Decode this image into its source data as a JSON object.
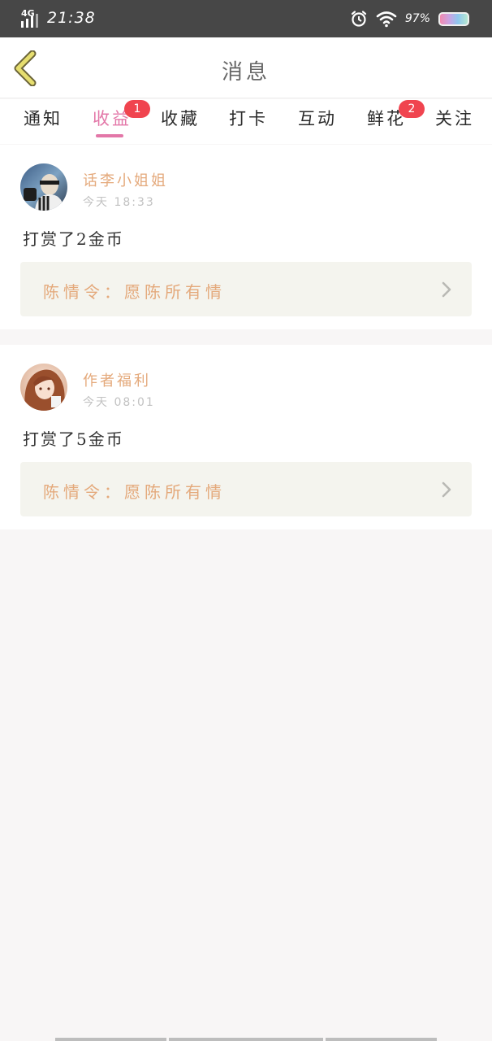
{
  "status_bar": {
    "network": "4G",
    "time": "21:38",
    "battery_pct": "97%",
    "battery_level": 0.97,
    "icons": [
      "signal-icon",
      "alarm-icon",
      "wifi-icon",
      "battery-icon"
    ]
  },
  "header": {
    "title": "消息",
    "back_icon": "chevron-left-icon",
    "accent_color": "#e6de6f"
  },
  "tabs": [
    {
      "label": "通知",
      "active": false,
      "badge": null
    },
    {
      "label": "收益",
      "active": true,
      "badge": "1"
    },
    {
      "label": "收藏",
      "active": false,
      "badge": null
    },
    {
      "label": "打卡",
      "active": false,
      "badge": null
    },
    {
      "label": "互动",
      "active": false,
      "badge": null
    },
    {
      "label": "鲜花",
      "active": false,
      "badge": "2"
    },
    {
      "label": "关注",
      "active": false,
      "badge": null
    }
  ],
  "colors": {
    "active_tab": "#e377a8",
    "badge": "#f0444f",
    "author": "#e4a97b",
    "work_title": "#e4a97b"
  },
  "messages": [
    {
      "author": "话李小姐姐",
      "time": "今天 18:33",
      "action": "打赏了2金币",
      "work_title": "陈情令：愿陈所有情"
    },
    {
      "author": "作者福利",
      "time": "今天 08:01",
      "action": "打赏了5金币",
      "work_title": "陈情令：愿陈所有情"
    }
  ]
}
